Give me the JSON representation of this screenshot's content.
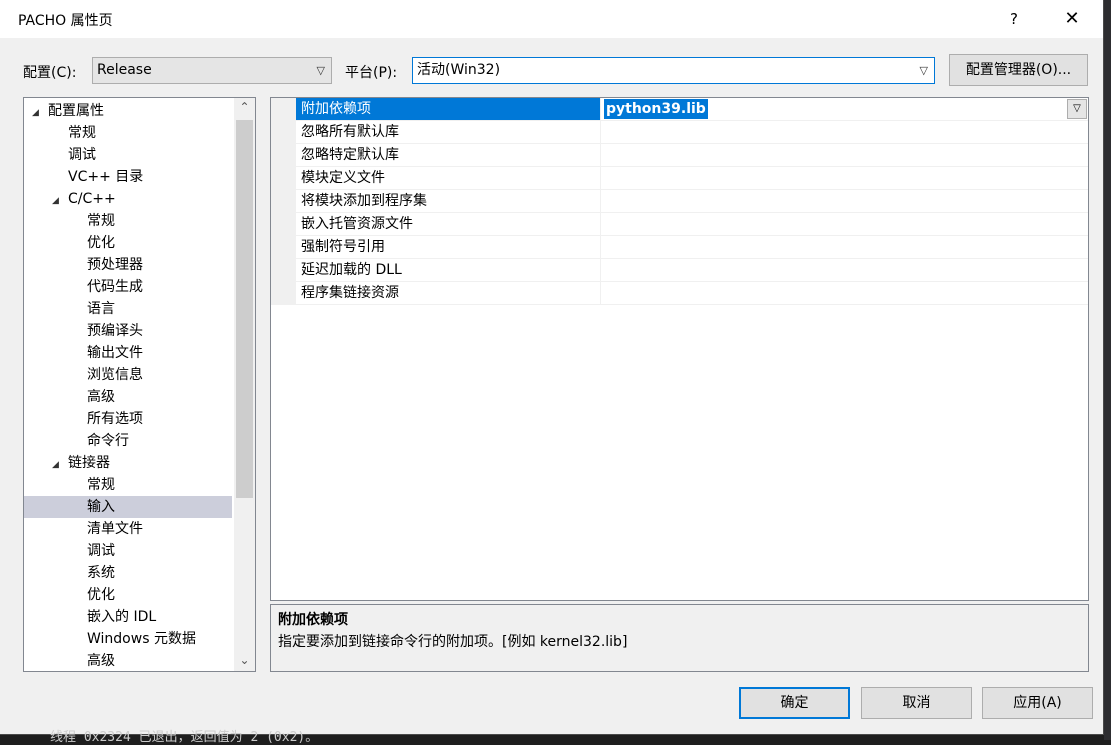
{
  "window": {
    "title": "PACHO 属性页",
    "help": "?",
    "close": "✕"
  },
  "toolbar": {
    "config_label": "配置(C):",
    "config_value": "Release",
    "platform_label": "平台(P):",
    "platform_value": "活动(Win32)",
    "config_manager": "配置管理器(O)..."
  },
  "tree": {
    "items": [
      {
        "label": "配置属性",
        "expander": "◢"
      },
      {
        "label": "常规"
      },
      {
        "label": "调试"
      },
      {
        "label": "VC++ 目录"
      },
      {
        "label": "C/C++",
        "expander": "◢"
      },
      {
        "label": "常规"
      },
      {
        "label": "优化"
      },
      {
        "label": "预处理器"
      },
      {
        "label": "代码生成"
      },
      {
        "label": "语言"
      },
      {
        "label": "预编译头"
      },
      {
        "label": "输出文件"
      },
      {
        "label": "浏览信息"
      },
      {
        "label": "高级"
      },
      {
        "label": "所有选项"
      },
      {
        "label": "命令行"
      },
      {
        "label": "链接器",
        "expander": "◢"
      },
      {
        "label": "常规"
      },
      {
        "label": "输入",
        "selected": true
      },
      {
        "label": "清单文件"
      },
      {
        "label": "调试"
      },
      {
        "label": "系统"
      },
      {
        "label": "优化"
      },
      {
        "label": "嵌入的 IDL"
      },
      {
        "label": "Windows 元数据"
      },
      {
        "label": "高级"
      }
    ],
    "scroll_up": "⌃",
    "scroll_down": "⌄"
  },
  "properties": {
    "rows": [
      {
        "name": "附加依赖项",
        "value": "python39.lib",
        "selected": true
      },
      {
        "name": "忽略所有默认库",
        "value": ""
      },
      {
        "name": "忽略特定默认库",
        "value": ""
      },
      {
        "name": "模块定义文件",
        "value": ""
      },
      {
        "name": "将模块添加到程序集",
        "value": ""
      },
      {
        "name": "嵌入托管资源文件",
        "value": ""
      },
      {
        "name": "强制符号引用",
        "value": ""
      },
      {
        "name": "延迟加载的 DLL",
        "value": ""
      },
      {
        "name": "程序集链接资源",
        "value": ""
      }
    ]
  },
  "description": {
    "title": "附加依赖项",
    "text": "指定要添加到链接命令行的附加项。[例如 kernel32.lib]"
  },
  "buttons": {
    "ok": "确定",
    "cancel": "取消",
    "apply": "应用(A)"
  },
  "background": {
    "console_line": "线程 0x2324 已退出，返回值为 2 (0x2)。"
  }
}
